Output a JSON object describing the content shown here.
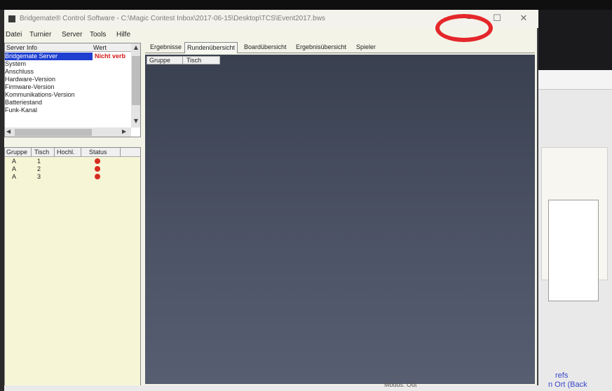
{
  "window": {
    "title": "Bridgemate® Control Software - C:\\Magic Contest Inbox\\2017-06-15\\Desktop\\TCS\\Event2017.bws"
  },
  "menu": [
    "Datei",
    "Turnier",
    "Server",
    "Tools",
    "Hilfe"
  ],
  "left_top": {
    "headers": [
      "Server Info",
      "Wert"
    ],
    "rows": [
      {
        "label": "Bridgemate Server",
        "selected": true
      },
      {
        "label": "System",
        "selected": false
      },
      {
        "label": "Anschluss",
        "selected": false
      },
      {
        "label": "Hardware-Version",
        "selected": false
      },
      {
        "label": "Firmware-Version",
        "selected": false
      },
      {
        "label": "Kommunikations-Version",
        "selected": false
      },
      {
        "label": "Batteriestand",
        "selected": false
      },
      {
        "label": "Funk-Kanal",
        "selected": false
      }
    ],
    "first_value": "Nicht verb"
  },
  "left_bottom": {
    "headers": [
      "Gruppe",
      "Tisch",
      "Hochl.",
      "Status"
    ],
    "rows": [
      {
        "gruppe": "A",
        "tisch": "1"
      },
      {
        "gruppe": "A",
        "tisch": "2"
      },
      {
        "gruppe": "A",
        "tisch": "3"
      }
    ]
  },
  "tabs": [
    "Ergebnisse",
    "Rundenübersicht",
    "Boardübersicht",
    "Ergebnisübersicht",
    "Spieler"
  ],
  "content": {
    "headers": [
      "Gruppe",
      "Tisch"
    ]
  },
  "status": {
    "text": "Modus: Out"
  },
  "background_window": {
    "link1": "refs",
    "link2": "n Ort (Back"
  }
}
